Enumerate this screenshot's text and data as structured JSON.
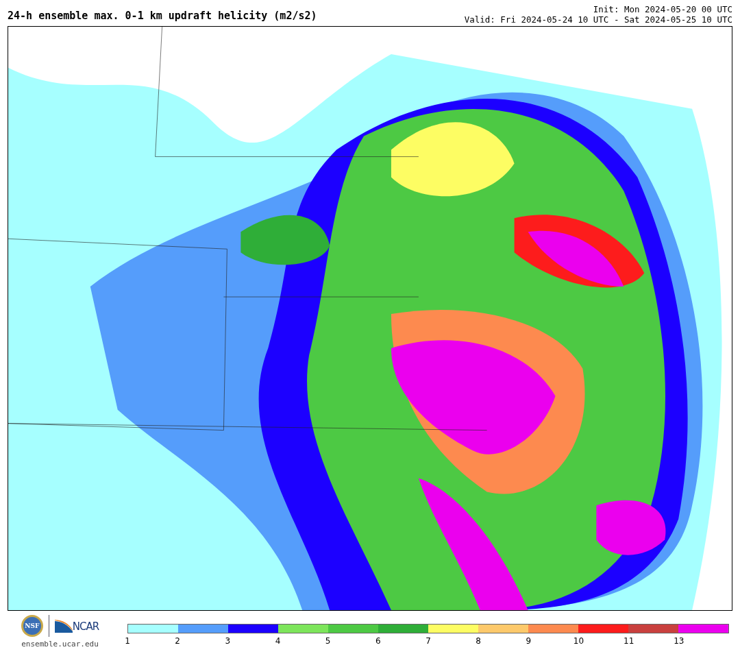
{
  "title": "24-h ensemble max. 0-1 km updraft helicity (m2/s2)",
  "init": "Init: Mon 2024-05-20 00 UTC",
  "valid": "Valid: Fri 2024-05-24 10 UTC - Sat 2024-05-25 10 UTC",
  "logos": {
    "seal": "NSF",
    "brand": "NCAR",
    "url": "ensemble.ucar.edu"
  },
  "legend": {
    "bins": [
      {
        "label": "1",
        "color": "#a6ffff"
      },
      {
        "label": "2",
        "color": "#559dfb"
      },
      {
        "label": "3",
        "color": "#1c00ff"
      },
      {
        "label": "4",
        "color": "#7de55b"
      },
      {
        "label": "5",
        "color": "#4dc944"
      },
      {
        "label": "6",
        "color": "#2fae38"
      },
      {
        "label": "7",
        "color": "#fdfd63"
      },
      {
        "label": "8",
        "color": "#fdc96b"
      },
      {
        "label": "9",
        "color": "#fd8a4f"
      },
      {
        "label": "10",
        "color": "#fd1c1c"
      },
      {
        "label": "11",
        "color": "#c9403e"
      },
      {
        "label": "13",
        "color": "#eb00ee"
      }
    ]
  }
}
